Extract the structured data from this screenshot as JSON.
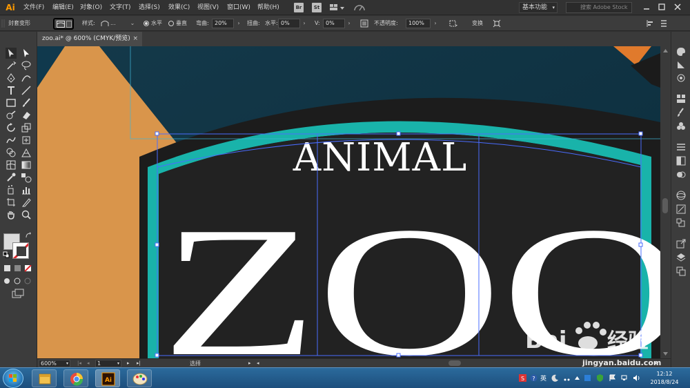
{
  "app": {
    "logo_text": "Ai",
    "menus": [
      "文件(F)",
      "编辑(E)",
      "对象(O)",
      "文字(T)",
      "选择(S)",
      "效果(C)",
      "视图(V)",
      "窗口(W)",
      "帮助(H)"
    ],
    "bridge_badge": "Br",
    "stock_badge": "St",
    "workspace_label": "基本功能",
    "search_placeholder": "搜索 Adobe Stock"
  },
  "controlbar": {
    "mode_label": "封套变形",
    "style_label": "样式:",
    "style_value": "...",
    "horizontal_label": "水平",
    "vertical_label": "垂直",
    "orientation_selected": "horizontal",
    "bend_label": "弯曲:",
    "bend_value": "20%",
    "distortion_label": "扭曲:",
    "horizontal_dist_label": "水平:",
    "horizontal_dist_value": "0%",
    "vertical_dist_label": "V:",
    "vertical_dist_value": "0%",
    "opacity_label": "不透明度:",
    "opacity_value": "100%",
    "transform_label": "变换"
  },
  "document": {
    "tab_title": "zoo.ai* @ 600% (CMYK/预览)",
    "close_glyph": "×"
  },
  "artwork": {
    "headline": "ANIMAL",
    "word": "ZOO",
    "colors": {
      "background": "#0e3344",
      "orange": "#d9954b",
      "teal": "#19b3aa",
      "sign": "#1f1f1f",
      "text": "#ffffff",
      "selection": "#4a6cff",
      "corner": "#e07a2c"
    }
  },
  "statusbar": {
    "zoom": "600%",
    "artboard": "1",
    "status": "选择"
  },
  "taskbar": {
    "lang": "英",
    "time": "12:12",
    "date": "2018/8/24"
  },
  "watermark": {
    "url": "jingyan.baidu.com"
  }
}
